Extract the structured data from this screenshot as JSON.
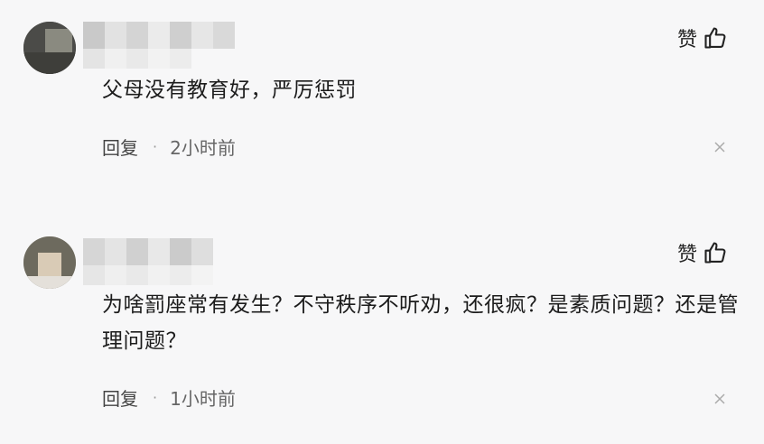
{
  "comments": [
    {
      "like_label": "赞",
      "text": "父母没有教育好，严厉惩罚",
      "reply_label": "回复",
      "separator": "·",
      "time": "2小时前"
    },
    {
      "like_label": "赞",
      "text": "为啥罰座常有发生？不守秩序不听劝，还很疯？是素质问题？还是管理问题？",
      "reply_label": "回复",
      "separator": "·",
      "time": "1小时前"
    }
  ],
  "icons": {
    "like": "thumbs-up-icon",
    "close": "close-icon"
  },
  "colors": {
    "background": "#f7f7f8",
    "text": "#1c1c1c",
    "meta": "#666666"
  }
}
